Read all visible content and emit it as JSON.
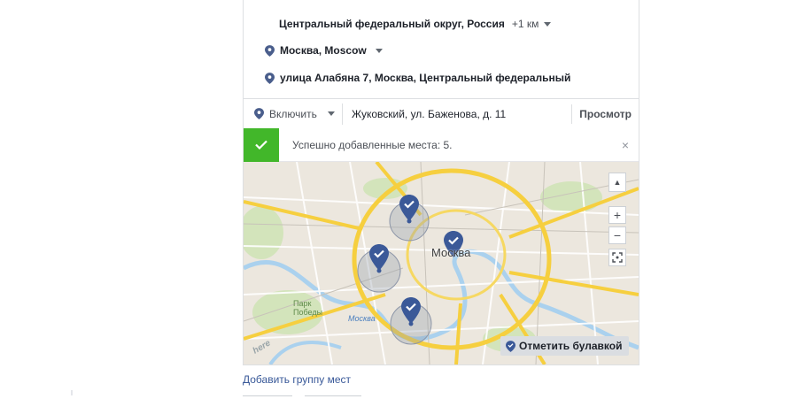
{
  "locations": {
    "region": {
      "label": "Центральный федеральный округ, Россия",
      "radius": "+1 км"
    },
    "city": {
      "label": "Москва, Moscow"
    },
    "street": {
      "label": "улица Алабяна 7, Москва, Центральный федеральный"
    }
  },
  "include_bar": {
    "include_label": "Включить",
    "address_value": "Жуковский, ул. Баженова, д. 11",
    "view_label": "Просмотр"
  },
  "notice": {
    "text": "Успешно добавленные места: 5.",
    "close_glyph": "×"
  },
  "map": {
    "city_label": "Москва",
    "park_label_1": "Парк",
    "park_label_2": "Победы",
    "river_label": "Москва",
    "brand": "here",
    "zoom_in": "+",
    "zoom_out": "−",
    "drop_pin_label": "Отметить булавкой",
    "colors": {
      "pin": "#3b5998",
      "road": "#f6cf3f",
      "green": "#cfe3b4",
      "water": "#a9d3f0"
    }
  },
  "add_group_label": "Добавить группу мест"
}
